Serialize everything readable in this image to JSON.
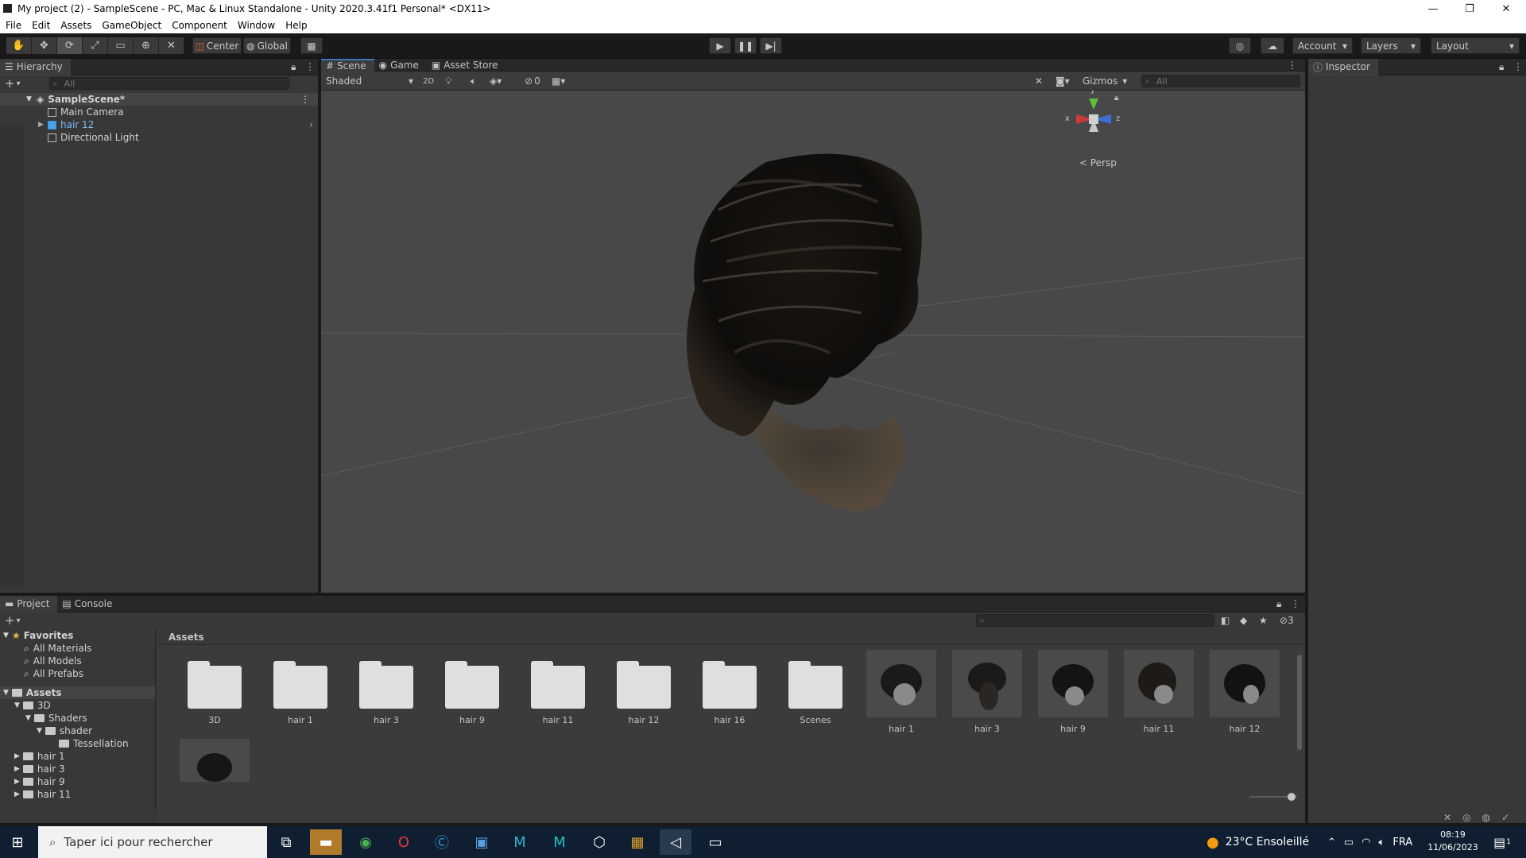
{
  "window": {
    "title": "My project (2) - SampleScene - PC, Mac & Linux Standalone - Unity 2020.3.41f1 Personal* <DX11>",
    "controls": {
      "minimize": "—",
      "maximize": "❐",
      "close": "✕"
    }
  },
  "menu": [
    "File",
    "Edit",
    "Assets",
    "GameObject",
    "Component",
    "Window",
    "Help"
  ],
  "toolbar": {
    "pivot": "Center",
    "space": "Global",
    "account": "Account",
    "layers": "Layers",
    "layout": "Layout"
  },
  "hierarchy": {
    "tab": "Hierarchy",
    "search_placeholder": "All",
    "scene": "SampleScene*",
    "items": [
      "Main Camera",
      "hair 12",
      "Directional Light"
    ]
  },
  "scene": {
    "tabs": [
      "Scene",
      "Game",
      "Asset Store"
    ],
    "shading": "Shaded",
    "mode2d": "2D",
    "hidden_count": "0",
    "gizmos": "Gizmos",
    "search_placeholder": "All",
    "persp": "Persp",
    "axes": {
      "y": "y",
      "x": "x",
      "z": "z"
    }
  },
  "inspector": {
    "tab": "Inspector"
  },
  "project": {
    "tabs": [
      "Project",
      "Console"
    ],
    "hidden_count": "3",
    "favorites_label": "Favorites",
    "favorites": [
      "All Materials",
      "All Models",
      "All Prefabs"
    ],
    "assets_label": "Assets",
    "tree": [
      {
        "label": "3D",
        "depth": 1,
        "open": true
      },
      {
        "label": "Shaders",
        "depth": 2,
        "open": true
      },
      {
        "label": "shader",
        "depth": 3,
        "open": true
      },
      {
        "label": "Tessellation",
        "depth": 4,
        "open": false
      },
      {
        "label": "hair 1",
        "depth": 1,
        "open": false
      },
      {
        "label": "hair 3",
        "depth": 1,
        "open": false
      },
      {
        "label": "hair 9",
        "depth": 1,
        "open": false
      },
      {
        "label": "hair 11",
        "depth": 1,
        "open": false
      }
    ],
    "breadcrumb": "Assets",
    "folders": [
      "3D",
      "hair 1",
      "hair 3",
      "hair 9",
      "hair 11",
      "hair 12",
      "hair 16",
      "Scenes"
    ],
    "models": [
      "hair 1",
      "hair 3",
      "hair 9",
      "hair 11",
      "hair 12"
    ]
  },
  "taskbar": {
    "search_placeholder": "Taper ici pour rechercher",
    "weather": "23°C  Ensoleillé",
    "lang": "FRA",
    "time": "08:19",
    "date": "11/06/2023",
    "notif_count": "1"
  }
}
